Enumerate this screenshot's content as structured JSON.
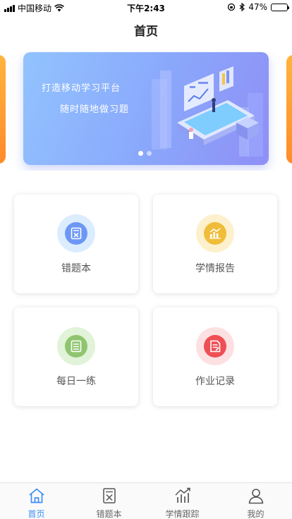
{
  "status_bar": {
    "carrier": "中国移动",
    "time": "下午2:43",
    "battery": "47%",
    "battery_level": 0.47
  },
  "nav": {
    "title": "首页"
  },
  "banner": {
    "line1": "打造移动学习平台",
    "line2": "随时随地做习题",
    "slide_count": 2,
    "active_slide": 1,
    "colors": {
      "start": "#92c3ff",
      "end": "#8f8ff5",
      "side_slides": "#ffa535"
    }
  },
  "features": [
    {
      "label": "错题本",
      "icon": "wrong-questions-icon",
      "halo": "#dcecff",
      "color": "#6c97f4"
    },
    {
      "label": "学情报告",
      "icon": "learning-report-icon",
      "halo": "#fdf0cc",
      "color": "#efbd39"
    },
    {
      "label": "每日一练",
      "icon": "daily-practice-icon",
      "halo": "#e1f3d9",
      "color": "#8fc56f"
    },
    {
      "label": "作业记录",
      "icon": "homework-record-icon",
      "halo": "#fde0e2",
      "color": "#ee4f55"
    }
  ],
  "tabbar": {
    "active_color": "#3d8ef7",
    "tabs": [
      {
        "label": "首页",
        "icon": "home-icon",
        "active": true
      },
      {
        "label": "错题本",
        "icon": "wrong-questions-tab-icon",
        "active": false
      },
      {
        "label": "学情跟踪",
        "icon": "trend-chart-icon",
        "active": false
      },
      {
        "label": "我的",
        "icon": "profile-icon",
        "active": false
      }
    ]
  }
}
